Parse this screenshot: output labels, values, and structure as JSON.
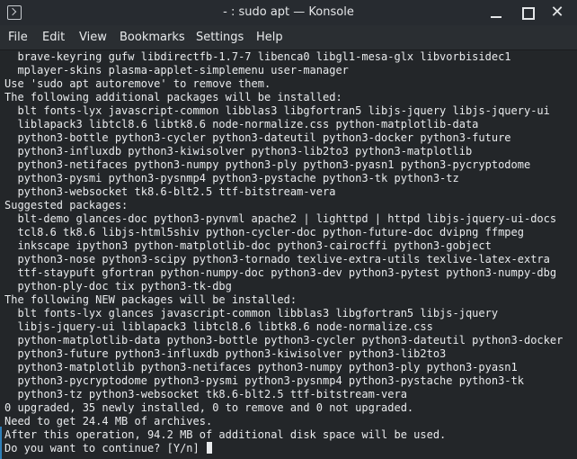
{
  "window": {
    "title": "- : sudo apt — Konsole",
    "minimize_label": "",
    "maximize_label": "",
    "close_label": "✕"
  },
  "menubar": {
    "file": "File",
    "edit": "Edit",
    "view": "View",
    "bookmarks": "Bookmarks",
    "settings": "Settings",
    "help": "Help"
  },
  "terminal": {
    "lines": [
      "  brave-keyring gufw libdirectfb-1.7-7 libenca0 libgl1-mesa-glx libvorbisidec1",
      "  mplayer-skins plasma-applet-simplemenu user-manager",
      "Use 'sudo apt autoremove' to remove them.",
      "The following additional packages will be installed:",
      "  blt fonts-lyx javascript-common libblas3 libgfortran5 libjs-jquery libjs-jquery-ui",
      "  liblapack3 libtcl8.6 libtk8.6 node-normalize.css python-matplotlib-data",
      "  python3-bottle python3-cycler python3-dateutil python3-docker python3-future",
      "  python3-influxdb python3-kiwisolver python3-lib2to3 python3-matplotlib",
      "  python3-netifaces python3-numpy python3-ply python3-pyasn1 python3-pycryptodome",
      "  python3-pysmi python3-pysnmp4 python3-pystache python3-tk python3-tz",
      "  python3-websocket tk8.6-blt2.5 ttf-bitstream-vera",
      "Suggested packages:",
      "  blt-demo glances-doc python3-pynvml apache2 | lighttpd | httpd libjs-jquery-ui-docs",
      "  tcl8.6 tk8.6 libjs-html5shiv python-cycler-doc python-future-doc dvipng ffmpeg",
      "  inkscape ipython3 python-matplotlib-doc python3-cairocffi python3-gobject",
      "  python3-nose python3-scipy python3-tornado texlive-extra-utils texlive-latex-extra",
      "  ttf-staypuft gfortran python-numpy-doc python3-dev python3-pytest python3-numpy-dbg",
      "  python-ply-doc tix python3-tk-dbg",
      "The following NEW packages will be installed:",
      "  blt fonts-lyx glances javascript-common libblas3 libgfortran5 libjs-jquery",
      "  libjs-jquery-ui liblapack3 libtcl8.6 libtk8.6 node-normalize.css",
      "  python-matplotlib-data python3-bottle python3-cycler python3-dateutil python3-docker",
      "  python3-future python3-influxdb python3-kiwisolver python3-lib2to3",
      "  python3-matplotlib python3-netifaces python3-numpy python3-ply python3-pyasn1",
      "  python3-pycryptodome python3-pysmi python3-pysnmp4 python3-pystache python3-tk",
      "  python3-tz python3-websocket tk8.6-blt2.5 ttf-bitstream-vera",
      "0 upgraded, 35 newly installed, 0 to remove and 0 not upgraded.",
      "Need to get 24.4 MB of archives.",
      "After this operation, 94.2 MB of additional disk space will be used."
    ],
    "prompt": "Do you want to continue? [Y/n] "
  }
}
